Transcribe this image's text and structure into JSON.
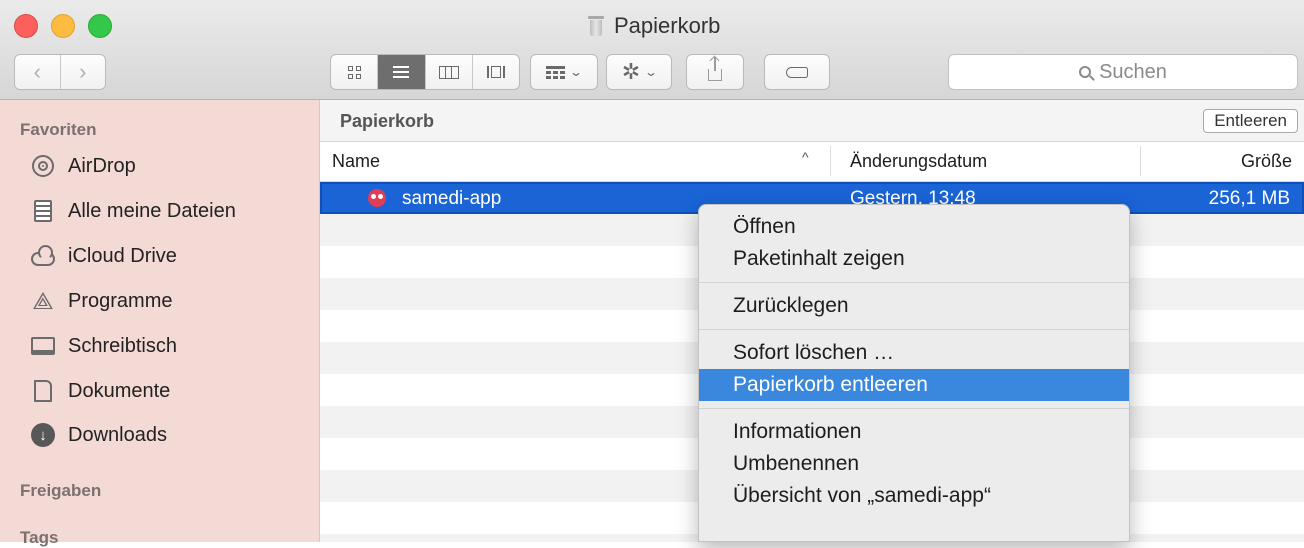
{
  "window": {
    "title": "Papierkorb"
  },
  "toolbar": {
    "back_label": "‹",
    "forward_label": "›",
    "view_modes": [
      "icon-view",
      "list-view",
      "column-view",
      "coverflow-view"
    ],
    "active_view_mode": "list-view",
    "action_glyph": "✲",
    "chevron": "⌄",
    "search_placeholder": "Suchen"
  },
  "sidebar": {
    "favorites_heading": "Favoriten",
    "items": [
      {
        "label": "AirDrop",
        "icon": "airdrop-icon"
      },
      {
        "label": "Alle meine Dateien",
        "icon": "all-files-icon"
      },
      {
        "label": "iCloud Drive",
        "icon": "cloud-icon"
      },
      {
        "label": "Programme",
        "icon": "applications-icon",
        "glyph": "⟁"
      },
      {
        "label": "Schreibtisch",
        "icon": "desktop-icon"
      },
      {
        "label": "Dokumente",
        "icon": "documents-icon"
      },
      {
        "label": "Downloads",
        "icon": "downloads-icon",
        "glyph": "↓"
      }
    ],
    "shared_heading": "Freigaben",
    "tags_heading": "Tags"
  },
  "main": {
    "path_title": "Papierkorb",
    "empty_button": "Entleeren",
    "columns": {
      "name": "Name",
      "sort_indicator": "^",
      "date": "Änderungsdatum",
      "size": "Größe"
    },
    "files": [
      {
        "name": "samedi-app",
        "date": "Gestern, 13:48",
        "size": "256,1 MB",
        "selected": true
      }
    ]
  },
  "context_menu": {
    "group1": [
      "Öffnen",
      "Paketinhalt zeigen"
    ],
    "group2": [
      "Zurücklegen"
    ],
    "group3": [
      "Sofort löschen …",
      "Papierkorb entleeren"
    ],
    "group4": [
      "Informationen",
      "Umbenennen",
      "Übersicht von „samedi-app“"
    ],
    "highlighted": "Papierkorb entleeren"
  },
  "colors": {
    "sidebar_bg": "#f4dad4",
    "selection": "#1a64d6",
    "menu_highlight": "#3a87de",
    "close": "#fc605c",
    "minimize": "#fdbc40",
    "zoom": "#34c84a"
  }
}
